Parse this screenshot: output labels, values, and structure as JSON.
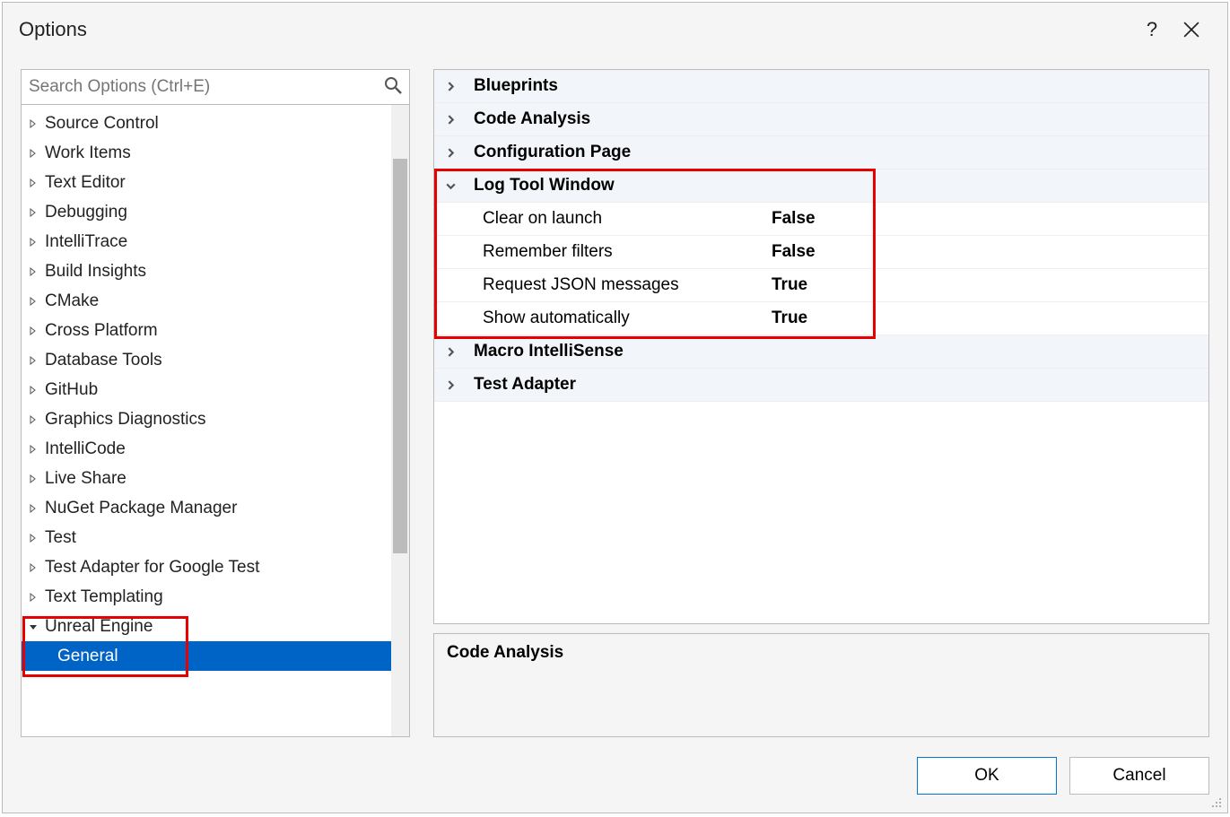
{
  "title": "Options",
  "search": {
    "placeholder": "Search Options (Ctrl+E)"
  },
  "tree": {
    "items": [
      {
        "label": "Source Control",
        "expanded": false
      },
      {
        "label": "Work Items",
        "expanded": false
      },
      {
        "label": "Text Editor",
        "expanded": false
      },
      {
        "label": "Debugging",
        "expanded": false
      },
      {
        "label": "IntelliTrace",
        "expanded": false
      },
      {
        "label": "Build Insights",
        "expanded": false
      },
      {
        "label": "CMake",
        "expanded": false
      },
      {
        "label": "Cross Platform",
        "expanded": false
      },
      {
        "label": "Database Tools",
        "expanded": false
      },
      {
        "label": "GitHub",
        "expanded": false
      },
      {
        "label": "Graphics Diagnostics",
        "expanded": false
      },
      {
        "label": "IntelliCode",
        "expanded": false
      },
      {
        "label": "Live Share",
        "expanded": false
      },
      {
        "label": "NuGet Package Manager",
        "expanded": false
      },
      {
        "label": "Test",
        "expanded": false
      },
      {
        "label": "Test Adapter for Google Test",
        "expanded": false
      },
      {
        "label": "Text Templating",
        "expanded": false
      },
      {
        "label": "Unreal Engine",
        "expanded": true,
        "children": [
          {
            "label": "General",
            "selected": true
          }
        ]
      }
    ]
  },
  "properties": {
    "categories": [
      {
        "label": "Blueprints",
        "expanded": false
      },
      {
        "label": "Code Analysis",
        "expanded": false
      },
      {
        "label": "Configuration Page",
        "expanded": false
      },
      {
        "label": "Log Tool Window",
        "expanded": true,
        "props": [
          {
            "label": "Clear on launch",
            "value": "False"
          },
          {
            "label": "Remember filters",
            "value": "False"
          },
          {
            "label": "Request JSON messages",
            "value": "True"
          },
          {
            "label": "Show automatically",
            "value": "True"
          }
        ]
      },
      {
        "label": "Macro IntelliSense",
        "expanded": false
      },
      {
        "label": "Test Adapter",
        "expanded": false
      }
    ]
  },
  "description": {
    "title": "Code Analysis"
  },
  "buttons": {
    "ok": "OK",
    "cancel": "Cancel"
  }
}
